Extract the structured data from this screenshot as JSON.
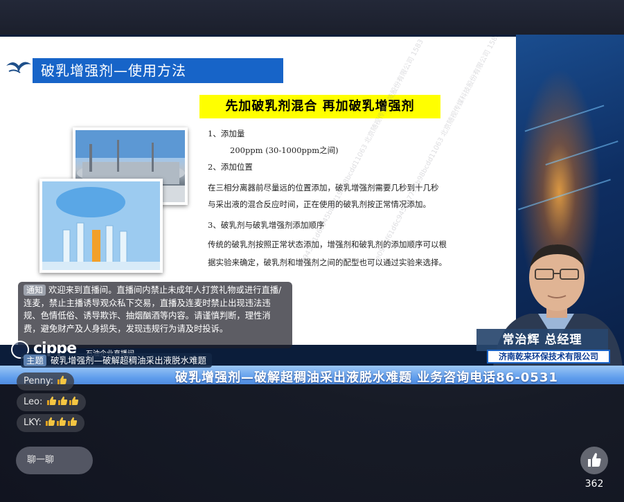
{
  "slide": {
    "title": "破乳增强剂—使用方法",
    "banner": "先加破乳剂混合    再加破乳增强剂",
    "section1_heading": "1、添加量",
    "section1_value": "200ppm   (30-1000ppm之间)",
    "section2_heading": "2、添加位置",
    "section2_line1": "    在三相分离器前尽量远的位置添加，破乳增强剂需要几秒到十几秒",
    "section2_line2": "与采出液的混合反应时间，正在使用的破乳剂按正常情况添加。",
    "section3_heading": "3、破乳剂与破乳增强剂添加顺序",
    "section3_line1": "传统的破乳剂按照正常状态添加，增强剂和破乳剂的添加顺序可以根",
    "section3_line2": "据实验来确定，破乳剂和增强剂之间的配型也可以通过实验来选择。",
    "watermark": "e0943f61d6c945bb7719b98bcdd11063 北京随视传媒科技股份有限公司 1583"
  },
  "presenter": {
    "name_title": "常治辉  总经理",
    "company": "济南乾来环保技术有限公司"
  },
  "ticker": {
    "text": "破乳增强剂—破解超稠油采出液脱水难题    业务咨询电话86-0531"
  },
  "notice": {
    "tag": "通知",
    "text": "欢迎来到直播间。直播间内禁止未成年人打赏礼物或进行直播/连麦，禁止主播诱导观众私下交易，直播及连麦时禁止出现违法违规、色情低俗、诱导欺诈、抽烟酗酒等内容。请谨慎判断，理性消费，避免财产及人身损失，发现违规行为请及时投诉。"
  },
  "brand": {
    "logo_word": "cippe",
    "logo_sub": "石油企业直播间"
  },
  "topic": {
    "tag": "主题",
    "text": "破乳增强剂—破解超稠油采出液脱水难题"
  },
  "comments": [
    {
      "user": "Penny:",
      "thumbs": 1
    },
    {
      "user": "Leo:",
      "thumbs": 3
    },
    {
      "user": "LKY:",
      "thumbs": 3
    }
  ],
  "chat": {
    "placeholder": "聊一聊"
  },
  "likes": {
    "count": "362"
  },
  "colors": {
    "title_blue": "#1764c8",
    "banner_yellow": "#ffff00",
    "ticker_blue": "#5e9cec",
    "company_blue": "#1a63c6"
  }
}
